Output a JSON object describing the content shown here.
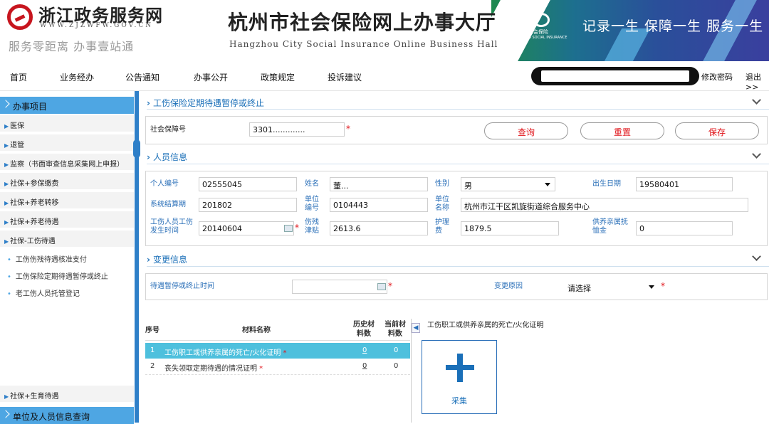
{
  "header": {
    "portal_name": "浙江政务服务网",
    "portal_url": "WWW.ZJZWFW.GOV.CN",
    "portal_slogan": "服务零距离 办事壹站通",
    "site_title": "杭州市社会保险网上办事大厅",
    "site_subtitle": "Hangzhou City Social Insurance Online Business Hall",
    "si_logo_cn": "中国社会保险",
    "si_logo_en": "CHINA SOCIAL INSURANCE",
    "motto": "记录一生  保障一生  服务一生"
  },
  "nav": {
    "items": [
      "首页",
      "业务经办",
      "公告通知",
      "办事公开",
      "政策规定",
      "投诉建议"
    ],
    "search_value": "",
    "change_password": "修改密码",
    "logout": "退出>>"
  },
  "sidebar": {
    "header": "办事项目",
    "items": [
      "医保",
      "退管",
      "监察（书面审查信息采集网上申报）",
      "社保+参保缴费",
      "社保+养老转移",
      "社保+养老待遇",
      "社保-工伤待遇"
    ],
    "subitems": [
      "工伤伤残待遇核准支付",
      "工伤保险定期待遇暂停或终止",
      "老工伤人员托管登记"
    ],
    "bottom_item": "社保+生育待遇",
    "bottom_header": "单位及人员信息查询"
  },
  "section_main": {
    "title": "工伤保险定期待遇暂停或终止",
    "ssn_label": "社会保障号",
    "ssn_value": "3301.............",
    "query_button": "查询",
    "reset_button": "重置",
    "save_button": "保存"
  },
  "section_person": {
    "title": "人员信息",
    "id_label": "个人编号",
    "id_value": "02555045",
    "name_label": "姓名",
    "name_value": "董...",
    "gender_label": "性别",
    "gender_value": "男",
    "birth_label": "出生日期",
    "birth_value": "19580401",
    "settle_label": "系统结算期",
    "settle_value": "201802",
    "unit_no_label": "单位编号",
    "unit_no_value": "0104443",
    "unit_name_label": "单位名称",
    "unit_name_value": "杭州市江干区凯旋街道综合服务中心",
    "injury_date_label": "工伤人员工伤发生时间",
    "injury_date_value": "20140604",
    "disability_label": "伤残津贴",
    "disability_value": "2613.6",
    "nursing_label": "护理费",
    "nursing_value": "1879.5",
    "dependent_label": "供养亲属抚恤金",
    "dependent_value": "0"
  },
  "section_change": {
    "title": "变更信息",
    "stop_time_label": "待遇暂停或终止时间",
    "stop_time_value": "",
    "reason_label": "变更原因",
    "reason_value": "请选择"
  },
  "materials": {
    "headers": {
      "no": "序号",
      "name": "材料名称",
      "history": "历史材料数",
      "current": "当前材料数"
    },
    "rows": [
      {
        "no": "1",
        "name": "工伤职工或供养亲属的死亡/火化证明",
        "history": "0",
        "current": "0"
      },
      {
        "no": "2",
        "name": "丧失领取定期待遇的情况证明",
        "history": "0",
        "current": "0"
      }
    ],
    "preview_title": "工伤职工或供养亲属的死亡/火化证明",
    "collect_label": "采集"
  },
  "colors": {
    "accent": "#2a6fb8",
    "sidebar_header": "#4ea6e3",
    "highlight_row": "#4ec0dd",
    "required": "#e0141a"
  }
}
